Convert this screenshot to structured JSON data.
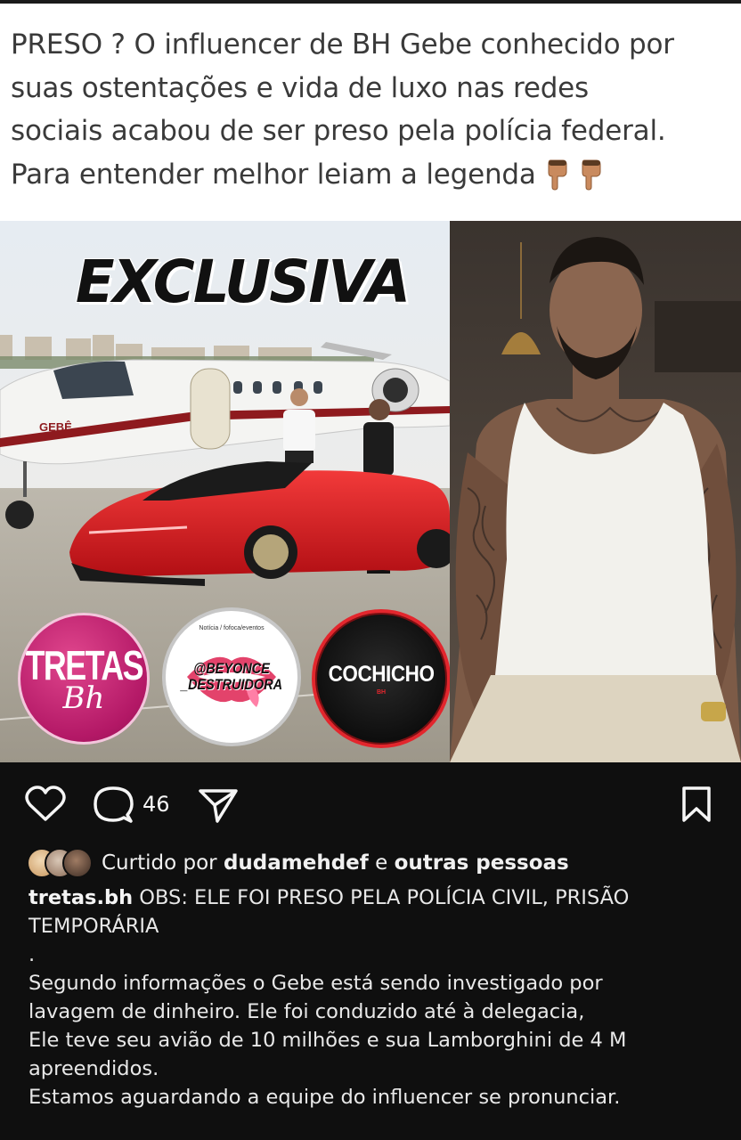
{
  "headline": {
    "line1": "PRESO ? O influencer de BH Gebe conhecido por",
    "line2": "suas ostentações e vida de luxo nas redes",
    "line3": "sociais acabou de ser preso pela polícia federal.",
    "line4": "Para entender melhor leiam a legenda"
  },
  "media": {
    "exclusive_title": "EXCLUSIVA",
    "plane_mark": "GEBÊ",
    "badges": {
      "tretas_top": "TRETAS",
      "tretas_bottom": "Bh",
      "beyonce_small": "Notícia / fofoca/eventos",
      "beyonce_handle_1": "@BEYONCE",
      "beyonce_handle_2": "_DESTRUIDORA",
      "cochicho": "COCHICHO",
      "cochicho_sub": "BH"
    }
  },
  "actions": {
    "comment_count": "46"
  },
  "likes": {
    "prefix": "Curtido por",
    "user": "dudamehdef",
    "connector": "e",
    "others": "outras pessoas"
  },
  "caption": {
    "username": "tretas.bh",
    "line1": "OBS: ELE FOI PRESO PELA POLÍCIA CIVIL, PRISÃO",
    "line2": "TEMPORÁRIA",
    "dot": ".",
    "line3": "Segundo informações o Gebe está sendo investigado por",
    "line4": "lavagem de dinheiro. Ele foi conduzido até à delegacia,",
    "line5": "Ele teve seu avião de 10 milhões e sua Lamborghini de 4 M",
    "line6": "apreendidos.",
    "line7": "Estamos aguardando a equipe do influencer se pronunciar."
  },
  "colors": {
    "background": "#0f0f0f",
    "text": "#f0f0f0",
    "headline_bg": "#ffffff",
    "car_red": "#e01b22",
    "tretas_pink": "#b31866",
    "cochicho_red": "#e3262d"
  }
}
